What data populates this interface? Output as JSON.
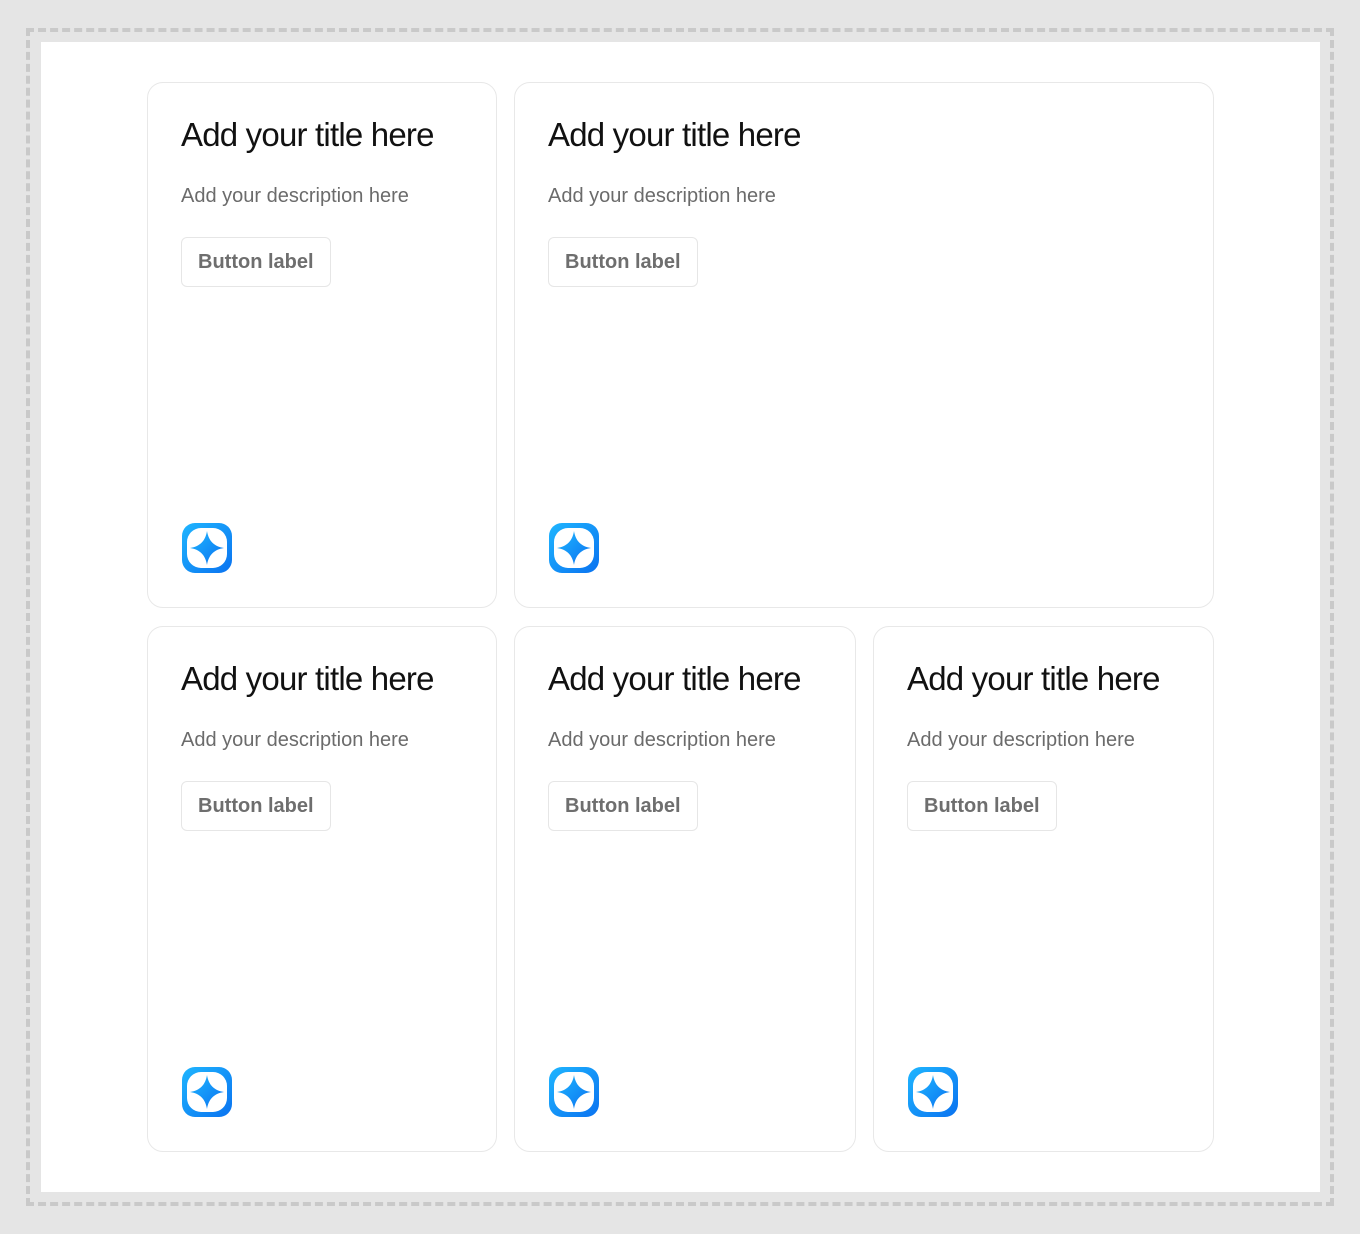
{
  "cards": [
    {
      "title": "Add your title here",
      "description": "Add your description here",
      "button_label": "Button label",
      "icon": "sparkle-app-icon"
    },
    {
      "title": "Add your title here",
      "description": "Add your description here",
      "button_label": "Button label",
      "icon": "sparkle-app-icon"
    },
    {
      "title": "Add your title here",
      "description": "Add your description here",
      "button_label": "Button label",
      "icon": "sparkle-app-icon"
    },
    {
      "title": "Add your title here",
      "description": "Add your description here",
      "button_label": "Button label",
      "icon": "sparkle-app-icon"
    },
    {
      "title": "Add your title here",
      "description": "Add your description here",
      "button_label": "Button label",
      "icon": "sparkle-app-icon"
    }
  ],
  "colors": {
    "icon_gradient_start": "#1fb6ff",
    "icon_gradient_end": "#0a72f0",
    "icon_inner": "#ffffff"
  }
}
